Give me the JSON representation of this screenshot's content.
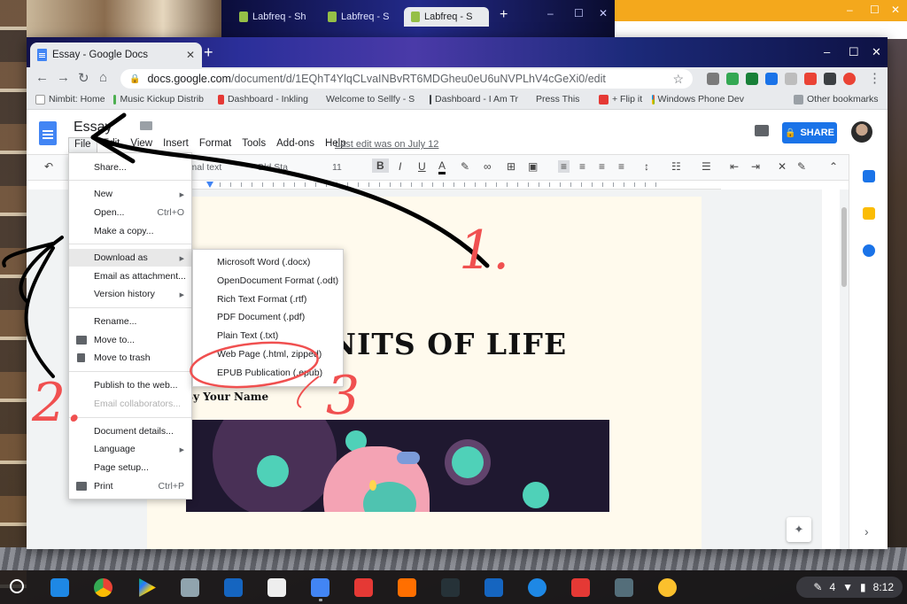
{
  "back_window": {
    "tabs": [
      "Labfreq - Sh",
      "Labfreq - S",
      "Labfreq - S"
    ],
    "new_tab": "+",
    "controls": [
      "–",
      "☐",
      "✕"
    ]
  },
  "orange_window": {
    "controls": [
      "–",
      "☐",
      "✕"
    ]
  },
  "browser": {
    "tab_title": "Essay - Google Docs",
    "tab_close": "✕",
    "new_tab": "+",
    "window_controls": [
      "–",
      "☐",
      "✕"
    ],
    "nav": {
      "back": "←",
      "forward": "→",
      "reload": "↻",
      "home": "⌂"
    },
    "url_domain": "docs.google.com",
    "url_path": "/document/d/1EQhT4YlqCLvaINBvRT6MDGheu0eU6uNVPLhV4cGeXi0/edit",
    "star": "☆",
    "bookmarks": [
      "Nimbit: Home",
      "Music Kickup Distrib",
      "Dashboard - Inkling",
      "Welcome to Sellfy - S",
      "Dashboard - I Am Tr",
      "Press This",
      "+ Flip it",
      "Windows Phone Dev"
    ],
    "other_bookmarks": "Other bookmarks"
  },
  "docs": {
    "title": "Essay",
    "menu": [
      "File",
      "Edit",
      "View",
      "Insert",
      "Format",
      "Tools",
      "Add-ons",
      "Help"
    ],
    "last_edit": "Last edit was on July 12",
    "share_label": "SHARE",
    "share_icon": "🔒",
    "toolbar": {
      "style": "rmal text",
      "font": "Old Sta",
      "size": "11",
      "bold": "B",
      "italic": "I",
      "underline": "U",
      "text_color": "A"
    }
  },
  "file_menu": {
    "items": [
      {
        "label": "Share...",
        "shortcut": ""
      },
      {
        "label": "New",
        "shortcut": "",
        "submenu": true
      },
      {
        "label": "Open...",
        "shortcut": "Ctrl+O"
      },
      {
        "label": "Make a copy...",
        "shortcut": ""
      },
      {
        "label": "Download as",
        "shortcut": "",
        "submenu": true,
        "highlighted": true
      },
      {
        "label": "Email as attachment...",
        "shortcut": ""
      },
      {
        "label": "Version history",
        "shortcut": "",
        "submenu": true
      },
      {
        "label": "Rename...",
        "shortcut": ""
      },
      {
        "label": "Move to...",
        "shortcut": ""
      },
      {
        "label": "Move to trash",
        "shortcut": ""
      },
      {
        "label": "Publish to the web...",
        "shortcut": ""
      },
      {
        "label": "Email collaborators...",
        "shortcut": "",
        "disabled": true
      },
      {
        "label": "Document details...",
        "shortcut": ""
      },
      {
        "label": "Language",
        "shortcut": "",
        "submenu": true
      },
      {
        "label": "Page setup...",
        "shortcut": ""
      },
      {
        "label": "Print",
        "shortcut": "Ctrl+P"
      }
    ],
    "submenu_arrow": "▶"
  },
  "download_submenu": {
    "items": [
      "Microsoft Word (.docx)",
      "OpenDocument Format (.odt)",
      "Rich Text Format (.rtf)",
      "PDF Document (.pdf)",
      "Plain Text (.txt)",
      "Web Page (.html, zipped)",
      "EPUB Publication (.epub)"
    ]
  },
  "document": {
    "heading": "UNITS OF LIFE",
    "byline": "By Your Name"
  },
  "annotations": {
    "one": "1.",
    "two": "2.",
    "three": "3"
  },
  "shelf": {
    "time": "8:12",
    "battery": "4"
  },
  "colors": {
    "docs_blue": "#4285f4",
    "share_blue": "#1a73e8",
    "annotation_red": "#f05050",
    "page_bg": "#fffaed"
  }
}
